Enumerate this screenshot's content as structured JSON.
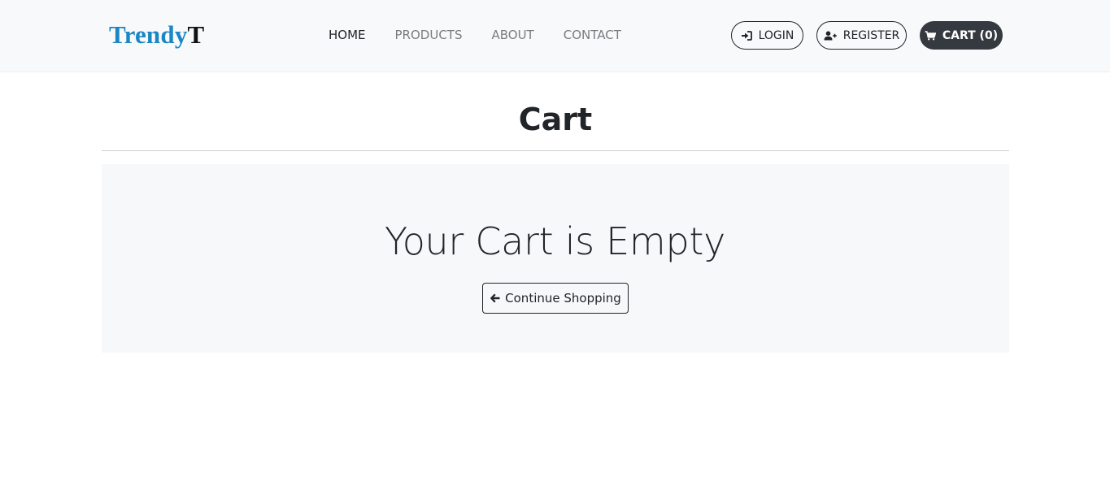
{
  "brand": {
    "part1": "Trendy",
    "part2": "T",
    "color_primary": "#1a86c4",
    "color_secondary": "#111111"
  },
  "nav": {
    "links": [
      {
        "label": "HOME",
        "active": true
      },
      {
        "label": "PRODUCTS",
        "active": false
      },
      {
        "label": "ABOUT",
        "active": false
      },
      {
        "label": "CONTACT",
        "active": false
      }
    ]
  },
  "actions": {
    "login": {
      "label": "LOGIN",
      "icon": "sign-in-icon"
    },
    "register": {
      "label": "REGISTER",
      "icon": "user-plus-icon"
    },
    "cart": {
      "label": "CART (0)",
      "icon": "cart-icon",
      "background": "#343a40"
    }
  },
  "page": {
    "title": "Cart"
  },
  "empty_state": {
    "message": "Your Cart is Empty",
    "button_label": "Continue Shopping",
    "button_icon": "arrow-left-icon"
  }
}
